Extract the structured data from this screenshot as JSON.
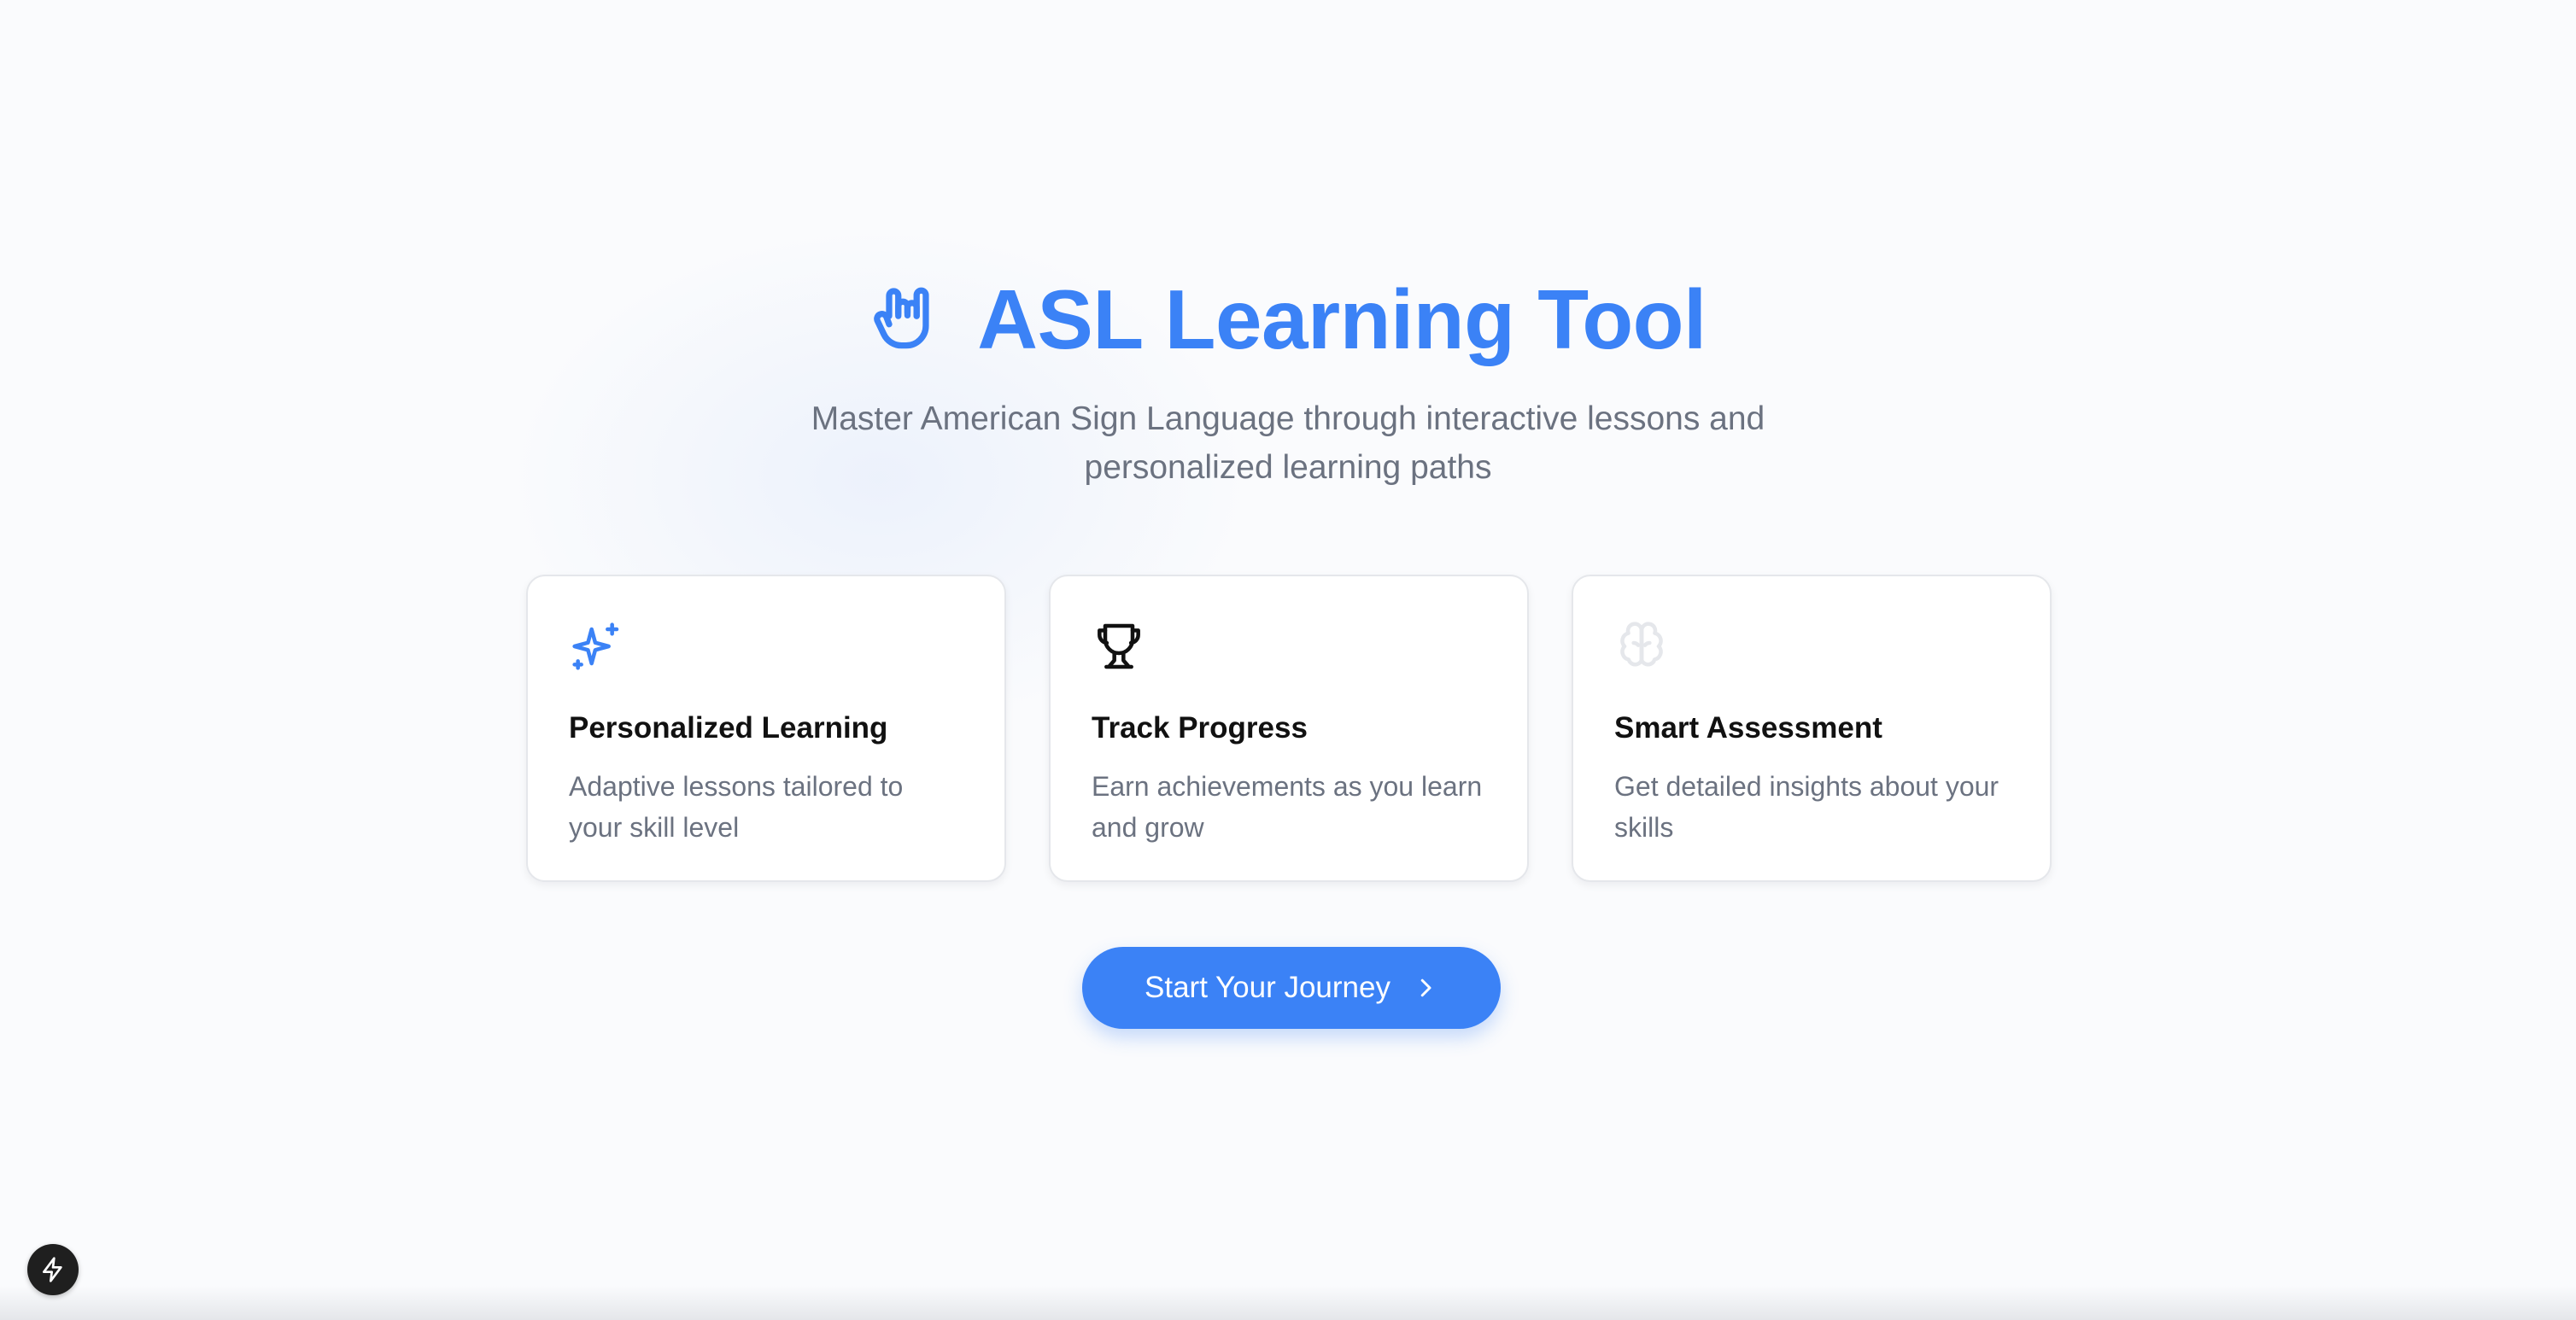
{
  "colors": {
    "accent": "#3b82f6",
    "text_muted": "#6b7280",
    "text_dark": "#111111",
    "card_border": "#e5e7eb",
    "brain_icon": "#e5e7eb"
  },
  "header": {
    "icon": "hand-sign-icon",
    "title": "ASL Learning Tool",
    "subtitle": "Master American Sign Language through interactive lessons and personalized learning paths"
  },
  "features": [
    {
      "icon": "sparkles-icon",
      "title": "Personalized Learning",
      "description": "Adaptive lessons tailored to your skill level"
    },
    {
      "icon": "trophy-icon",
      "title": "Track Progress",
      "description": "Earn achievements as you learn and grow"
    },
    {
      "icon": "brain-icon",
      "title": "Smart Assessment",
      "description": "Get detailed insights about your skills"
    }
  ],
  "cta": {
    "label": "Start Your Journey",
    "icon": "chevron-right-icon"
  },
  "dev_badge": {
    "icon": "lightning-icon"
  }
}
